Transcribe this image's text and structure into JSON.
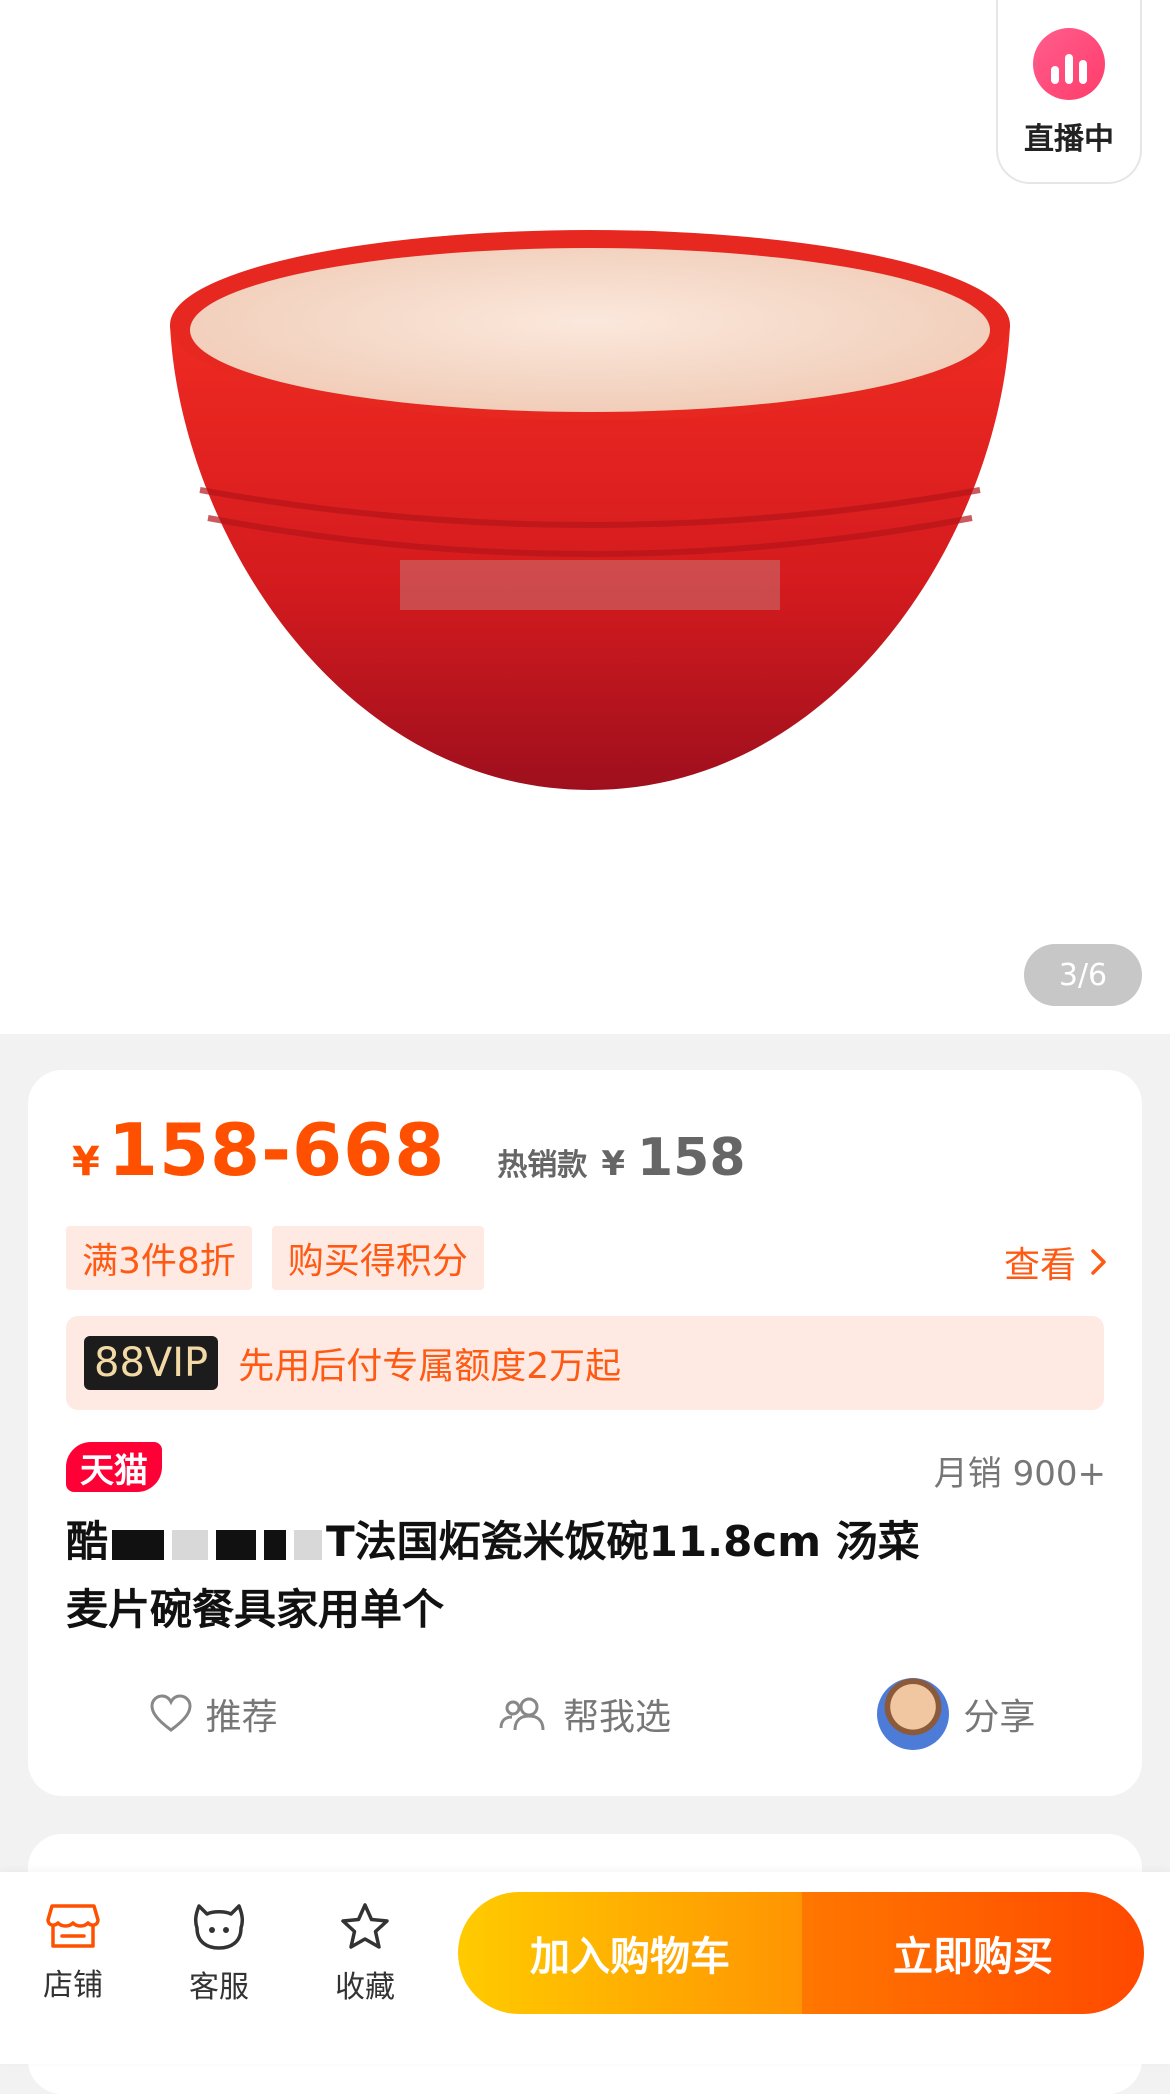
{
  "gallery": {
    "live_label": "直播中",
    "pager": "3/6"
  },
  "price": {
    "currency": "¥",
    "range": "158-668",
    "hot_label": "热销款",
    "hot_currency": "¥",
    "hot_price": "158"
  },
  "promos": {
    "tags": [
      "满3件8折",
      "购买得积分"
    ],
    "view_label": "查看",
    "vip_badge": "88VIP",
    "vip_text": "先用后付专属额度2万起"
  },
  "product": {
    "store_tag": "天猫",
    "monthly_sales": "月销 900+",
    "title_prefix": "酷",
    "title_visible": "T法国炻瓷米饭碗11.8cm 汤菜",
    "title_line2": "麦片碗餐具家用单个"
  },
  "actions": {
    "recommend": "推荐",
    "help_choose": "帮我选",
    "share": "分享"
  },
  "bottom": {
    "store": "店铺",
    "service": "客服",
    "favorite": "收藏",
    "add_cart": "加入购物车",
    "buy_now": "立即购买"
  },
  "colors": {
    "accent": "#ff5000",
    "tmall_red": "#ff0036",
    "bowl_red": "#d81e1e"
  }
}
